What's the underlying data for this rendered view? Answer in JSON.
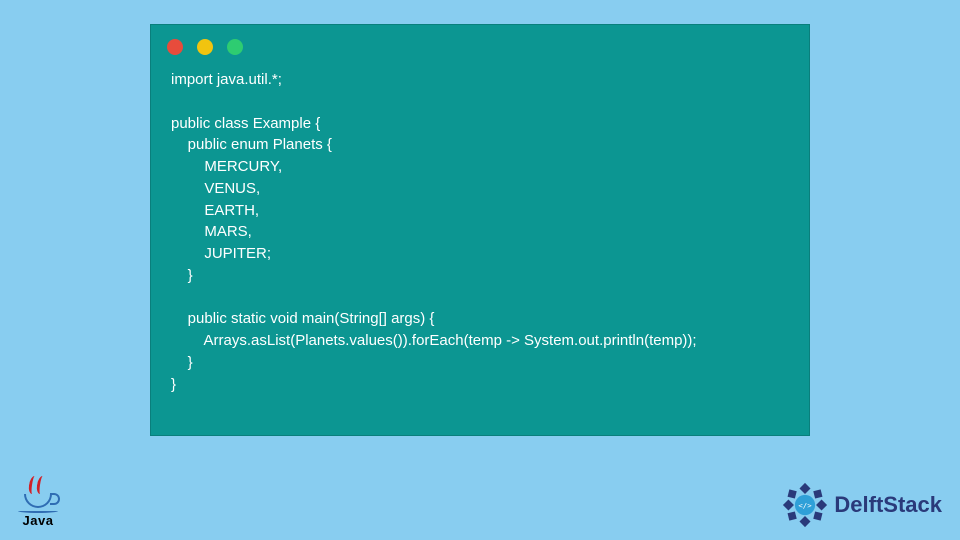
{
  "window": {
    "traffic_colors": [
      "#e74c3c",
      "#f1c40f",
      "#2ecc71"
    ]
  },
  "code": {
    "lines": [
      "import java.util.*;",
      "",
      "public class Example {",
      "    public enum Planets {",
      "        MERCURY,",
      "        VENUS,",
      "        EARTH,",
      "        MARS,",
      "        JUPITER;",
      "    }",
      "",
      "    public static void main(String[] args) {",
      "        Arrays.asList(Planets.values()).forEach(temp -> System.out.println(temp));",
      "    }",
      "}"
    ]
  },
  "footer": {
    "java_label": "Java",
    "brand": "DelftStack"
  }
}
